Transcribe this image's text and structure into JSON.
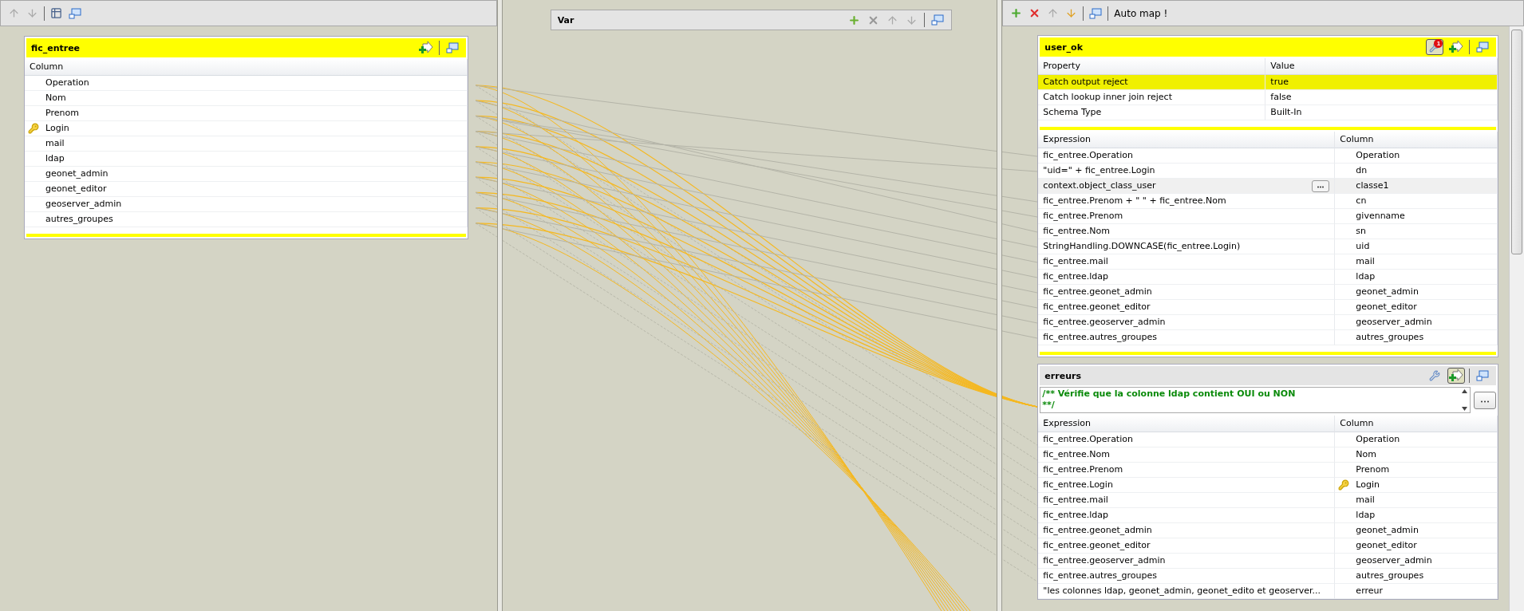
{
  "input_panel": {
    "table": {
      "title": "fic_entree",
      "selected": true,
      "column_header": "Column",
      "rows": [
        {
          "name": "Operation",
          "key": false
        },
        {
          "name": "Nom",
          "key": false
        },
        {
          "name": "Prenom",
          "key": false
        },
        {
          "name": "Login",
          "key": true
        },
        {
          "name": "mail",
          "key": false
        },
        {
          "name": "ldap",
          "key": false
        },
        {
          "name": "geonet_admin",
          "key": false
        },
        {
          "name": "geonet_editor",
          "key": false
        },
        {
          "name": "geoserver_admin",
          "key": false
        },
        {
          "name": "autres_groupes",
          "key": false
        }
      ]
    }
  },
  "var_panel": {
    "title": "Var"
  },
  "output_panel": {
    "toolbar": {
      "automap_label": "Auto map !"
    },
    "tables": [
      {
        "title": "user_ok",
        "selected": true,
        "filter_on": true,
        "filter_badge": "1",
        "reject_on": false,
        "property_header": "Property",
        "value_header": "Value",
        "properties": [
          {
            "name": "Catch output reject",
            "value": "true",
            "selected": true
          },
          {
            "name": "Catch lookup inner join reject",
            "value": "false",
            "selected": false
          },
          {
            "name": "Schema Type",
            "value": "Built-In",
            "selected": false
          }
        ],
        "expression_header": "Expression",
        "column_header": "Column",
        "rows": [
          {
            "expression": "fic_entree.Operation",
            "column": "Operation",
            "key": false,
            "selected": false
          },
          {
            "expression": "\"uid=\"  + fic_entree.Login",
            "column": "dn",
            "key": false,
            "selected": false
          },
          {
            "expression": "context.object_class_user",
            "column": "classe1",
            "key": false,
            "selected": true
          },
          {
            "expression": "fic_entree.Prenom + \" \" + fic_entree.Nom",
            "column": "cn",
            "key": false,
            "selected": false
          },
          {
            "expression": "fic_entree.Prenom",
            "column": "givenname",
            "key": false,
            "selected": false
          },
          {
            "expression": "fic_entree.Nom",
            "column": "sn",
            "key": false,
            "selected": false
          },
          {
            "expression": "StringHandling.DOWNCASE(fic_entree.Login)",
            "column": "uid",
            "key": false,
            "selected": false
          },
          {
            "expression": "fic_entree.mail",
            "column": "mail",
            "key": false,
            "selected": false
          },
          {
            "expression": "fic_entree.ldap",
            "column": "ldap",
            "key": false,
            "selected": false
          },
          {
            "expression": "fic_entree.geonet_admin",
            "column": "geonet_admin",
            "key": false,
            "selected": false
          },
          {
            "expression": "fic_entree.geonet_editor",
            "column": "geonet_editor",
            "key": false,
            "selected": false
          },
          {
            "expression": "fic_entree.geoserver_admin",
            "column": "geoserver_admin",
            "key": false,
            "selected": false
          },
          {
            "expression": "fic_entree.autres_groupes",
            "column": "autres_groupes",
            "key": false,
            "selected": false
          }
        ]
      },
      {
        "title": "erreurs",
        "selected": false,
        "filter_on": false,
        "reject_on": true,
        "filter_lines": [
          "/** Vérifie que la colonne ldap contient OUI ou NON",
          "**/"
        ],
        "expression_header": "Expression",
        "column_header": "Column",
        "rows": [
          {
            "expression": "fic_entree.Operation",
            "column": "Operation",
            "key": false,
            "selected": false
          },
          {
            "expression": "fic_entree.Nom",
            "column": "Nom",
            "key": false,
            "selected": false
          },
          {
            "expression": "fic_entree.Prenom",
            "column": "Prenom",
            "key": false,
            "selected": false
          },
          {
            "expression": "fic_entree.Login",
            "column": "Login",
            "key": true,
            "selected": false
          },
          {
            "expression": "fic_entree.mail",
            "column": "mail",
            "key": false,
            "selected": false
          },
          {
            "expression": "fic_entree.ldap",
            "column": "ldap",
            "key": false,
            "selected": false
          },
          {
            "expression": "fic_entree.geonet_admin",
            "column": "geonet_admin",
            "key": false,
            "selected": false
          },
          {
            "expression": "fic_entree.geonet_editor",
            "column": "geonet_editor",
            "key": false,
            "selected": false
          },
          {
            "expression": "fic_entree.geoserver_admin",
            "column": "geoserver_admin",
            "key": false,
            "selected": false
          },
          {
            "expression": "fic_entree.autres_groupes",
            "column": "autres_groupes",
            "key": false,
            "selected": false
          },
          {
            "expression": "\"les colonnes ldap, geonet_admin, geonet_edito et geoserver...",
            "column": "erreur",
            "key": false,
            "selected": false
          }
        ]
      }
    ]
  }
}
